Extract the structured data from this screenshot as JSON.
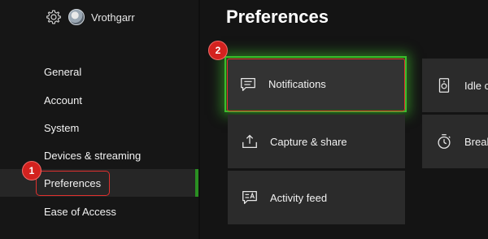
{
  "profile": {
    "gamertag": "Vrothgarr",
    "settings_icon": "gear-icon",
    "avatar_icon": "avatar"
  },
  "sidebar": {
    "items": [
      {
        "label": "General"
      },
      {
        "label": "Account"
      },
      {
        "label": "System"
      },
      {
        "label": "Devices & streaming"
      },
      {
        "label": "Preferences",
        "selected": true
      },
      {
        "label": "Ease of Access"
      }
    ]
  },
  "page": {
    "title": "Preferences"
  },
  "tiles": [
    {
      "label": "Notifications",
      "icon": "notification-icon",
      "focused": true
    },
    {
      "label": "Capture & share",
      "icon": "upload-icon"
    },
    {
      "label": "Activity feed",
      "icon": "activity-feed-icon"
    },
    {
      "label": "Idle c",
      "icon": "speaker-icon"
    },
    {
      "label": "Break",
      "icon": "timer-icon"
    }
  ],
  "annotations": {
    "step1": "1",
    "step2": "2"
  },
  "colors": {
    "accent_green": "#3bbd2c",
    "annotation_red": "#d3221f",
    "background": "#141414",
    "tile": "#2b2b2b"
  }
}
